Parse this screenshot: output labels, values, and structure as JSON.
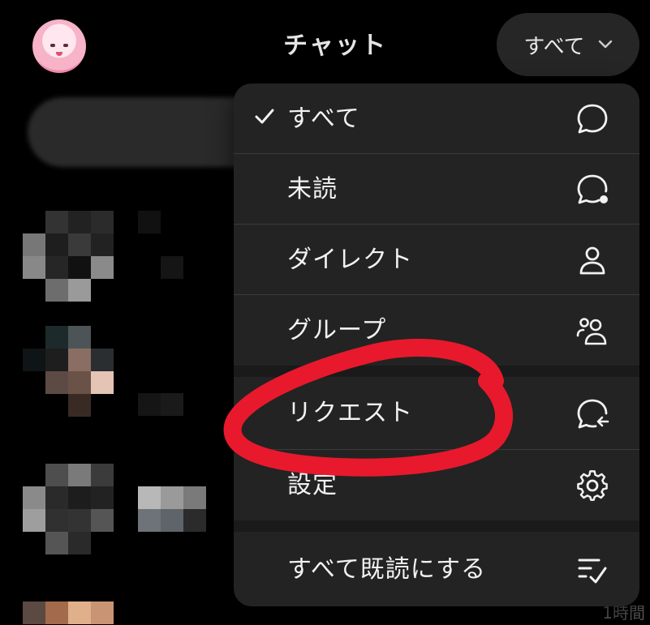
{
  "header": {
    "title": "チャット",
    "filter_label": "すべて",
    "avatar_icon": "character-avatar"
  },
  "menu": {
    "items": [
      {
        "label": "すべて",
        "icon": "chat-bubble-icon",
        "selected": true
      },
      {
        "label": "未読",
        "icon": "unread-bubble-icon",
        "selected": false
      },
      {
        "label": "ダイレクト",
        "icon": "person-icon",
        "selected": false
      },
      {
        "label": "グループ",
        "icon": "group-icon",
        "selected": false
      },
      {
        "label": "リクエスト",
        "icon": "request-bubble-icon",
        "selected": false
      },
      {
        "label": "設定",
        "icon": "gear-icon",
        "selected": false
      },
      {
        "label": "すべて既読にする",
        "icon": "mark-all-read-icon",
        "selected": false
      }
    ]
  },
  "background": {
    "time_text": "1時間"
  },
  "colors": {
    "background": "#000000",
    "menu_bg": "#232323",
    "annotation": "#e8192c"
  }
}
